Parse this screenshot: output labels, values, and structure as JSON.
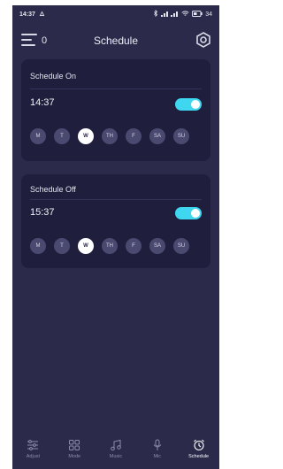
{
  "status_bar": {
    "time": "14:37",
    "battery": "34"
  },
  "header": {
    "count": "0",
    "title": "Schedule"
  },
  "cards": [
    {
      "title": "Schedule On",
      "time": "14:37",
      "enabled": true,
      "days": [
        {
          "label": "M",
          "active": false
        },
        {
          "label": "T",
          "active": false
        },
        {
          "label": "W",
          "active": true
        },
        {
          "label": "TH",
          "active": false
        },
        {
          "label": "F",
          "active": false
        },
        {
          "label": "SA",
          "active": false
        },
        {
          "label": "SU",
          "active": false
        }
      ]
    },
    {
      "title": "Schedule Off",
      "time": "15:37",
      "enabled": true,
      "days": [
        {
          "label": "M",
          "active": false
        },
        {
          "label": "T",
          "active": false
        },
        {
          "label": "W",
          "active": true
        },
        {
          "label": "TH",
          "active": false
        },
        {
          "label": "F",
          "active": false
        },
        {
          "label": "SA",
          "active": false
        },
        {
          "label": "SU",
          "active": false
        }
      ]
    }
  ],
  "tabs": [
    {
      "label": "Adjust",
      "icon": "sliders-icon",
      "active": false
    },
    {
      "label": "Mode",
      "icon": "grid-icon",
      "active": false
    },
    {
      "label": "Music",
      "icon": "music-icon",
      "active": false
    },
    {
      "label": "Mic",
      "icon": "mic-icon",
      "active": false
    },
    {
      "label": "Schedule",
      "icon": "alarm-clock-icon",
      "active": true
    }
  ],
  "colors": {
    "background": "#2b2a4b",
    "card": "#1f1e3c",
    "accent": "#3fd6f0"
  }
}
